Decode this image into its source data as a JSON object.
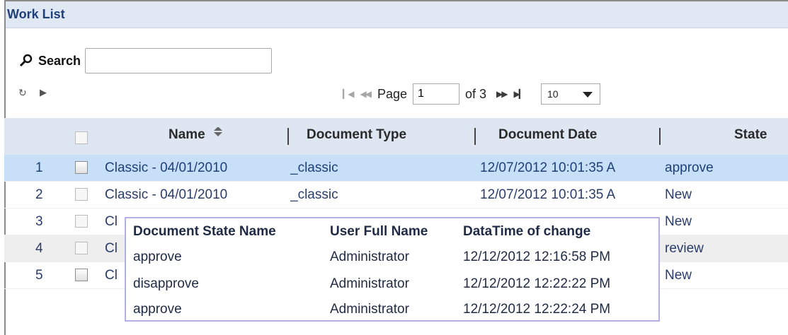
{
  "panel": {
    "title": "Work List"
  },
  "search": {
    "label": "Search",
    "value": ""
  },
  "pager": {
    "page_label": "Page",
    "page_value": "1",
    "of_text": "of 3",
    "page_size": "10"
  },
  "grid": {
    "columns": [
      "Name",
      "Document Type",
      "Document Date",
      "State"
    ],
    "rows": [
      {
        "num": "1",
        "name": "Classic - 04/01/2010",
        "type": "_classic",
        "date": "12/07/2012 10:01:35 A",
        "state": "approve"
      },
      {
        "num": "2",
        "name": "Classic - 04/01/2010",
        "type": "_classic",
        "date": "12/07/2012 10:01:35 A",
        "state": "New"
      },
      {
        "num": "3",
        "name": "Cl",
        "type": "",
        "date": "",
        "state": "New"
      },
      {
        "num": "4",
        "name": "Cl",
        "type": "",
        "date": "",
        "state": "review"
      },
      {
        "num": "5",
        "name": "Cl",
        "type": "",
        "date": "",
        "state": "New"
      }
    ]
  },
  "history_popup": {
    "headers": [
      "Document State Name",
      "User Full Name",
      "DataTime of change"
    ],
    "rows": [
      {
        "state": "approve",
        "user": "Administrator",
        "time": "12/12/2012 12:16:58 PM"
      },
      {
        "state": "disapprove",
        "user": "Administrator",
        "time": "12/12/2012 12:22:22 PM"
      },
      {
        "state": "approve",
        "user": "Administrator",
        "time": "12/12/2012 12:22:24 PM"
      }
    ]
  },
  "icons": {
    "search": "search-icon",
    "refresh": "refresh-icon",
    "play": "play-icon",
    "first": "first-page-icon",
    "prev": "prev-page-icon",
    "next": "next-page-icon",
    "last": "last-page-icon",
    "sort": "sort-icon",
    "dropdown": "chevron-down-icon"
  },
  "colors": {
    "header_bg": "#dfe8f3",
    "selected_row": "#c8e0f7",
    "alt_row": "#eeeeee",
    "popup_border": "#b3b0e6"
  }
}
